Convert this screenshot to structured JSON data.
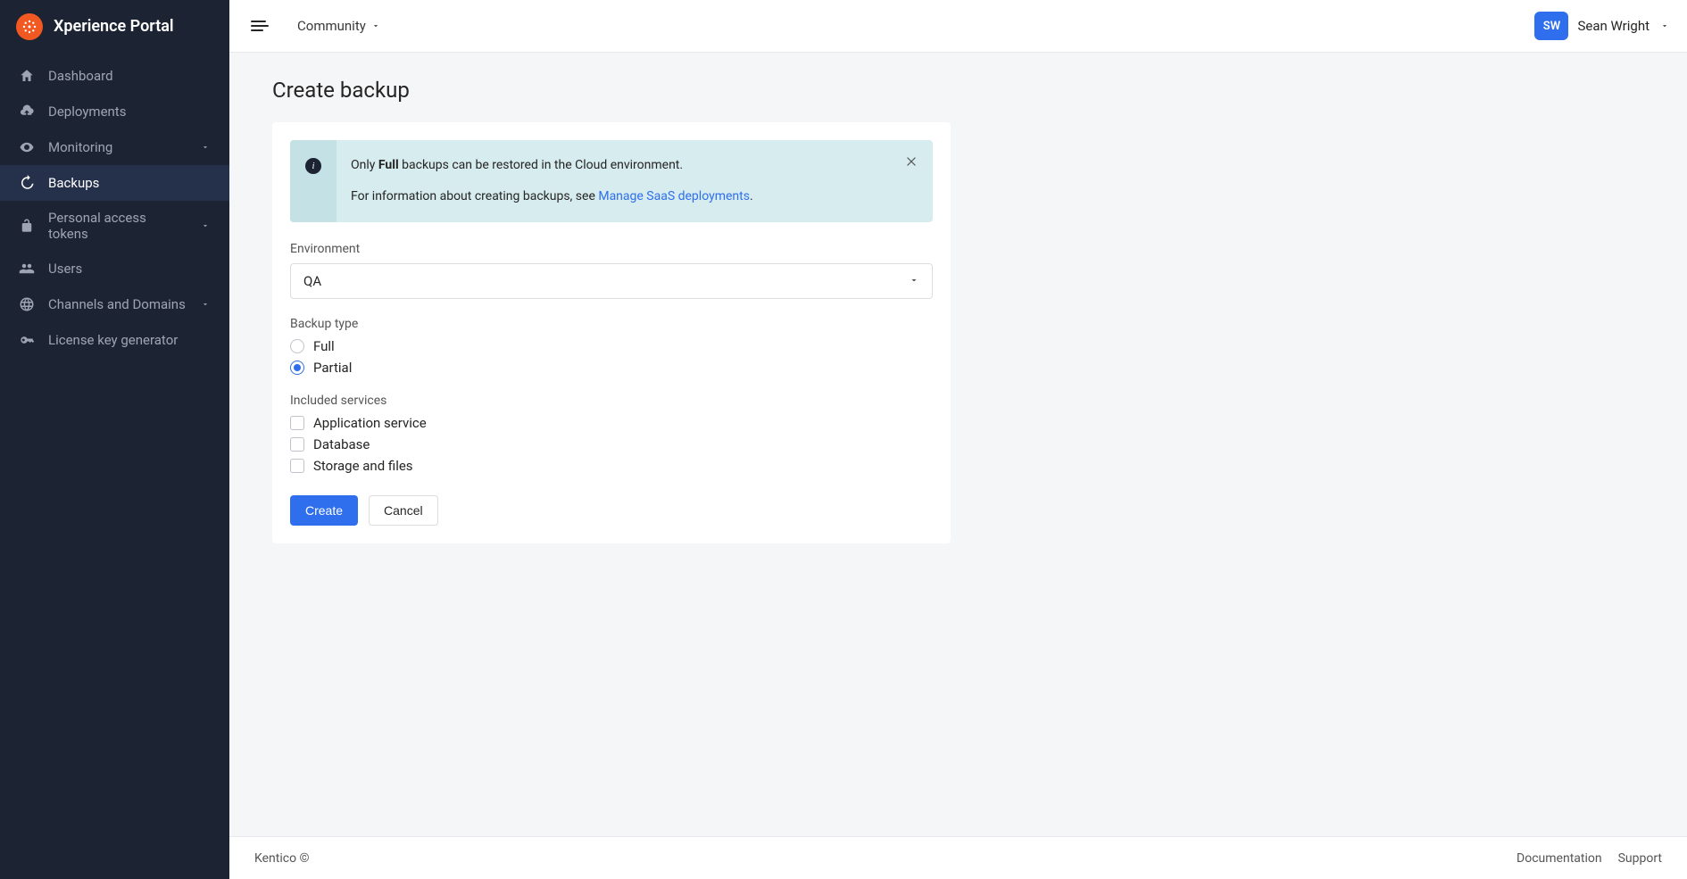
{
  "brand": {
    "title": "Xperience Portal"
  },
  "sidebar": {
    "items": [
      {
        "label": "Dashboard",
        "icon": "home-icon",
        "active": false,
        "expandable": false
      },
      {
        "label": "Deployments",
        "icon": "cloud-upload-icon",
        "active": false,
        "expandable": false
      },
      {
        "label": "Monitoring",
        "icon": "eye-icon",
        "active": false,
        "expandable": true
      },
      {
        "label": "Backups",
        "icon": "history-icon",
        "active": true,
        "expandable": false
      },
      {
        "label": "Personal access tokens",
        "icon": "lock-open-icon",
        "active": false,
        "expandable": true
      },
      {
        "label": "Users",
        "icon": "users-icon",
        "active": false,
        "expandable": false
      },
      {
        "label": "Channels and Domains",
        "icon": "globe-icon",
        "active": false,
        "expandable": true
      },
      {
        "label": "License key generator",
        "icon": "key-icon",
        "active": false,
        "expandable": false
      }
    ]
  },
  "topbar": {
    "project": "Community",
    "user": {
      "initials": "SW",
      "name": "Sean Wright"
    }
  },
  "page": {
    "title": "Create backup",
    "alert": {
      "line1_pre": "Only ",
      "line1_bold": "Full",
      "line1_post": " backups can be restored in the Cloud environment.",
      "line2_pre": "For information about creating backups, see ",
      "line2_link": "Manage SaaS deployments",
      "line2_post": "."
    },
    "environment": {
      "label": "Environment",
      "value": "QA"
    },
    "backup_type": {
      "label": "Backup type",
      "options": [
        {
          "label": "Full",
          "selected": false
        },
        {
          "label": "Partial",
          "selected": true
        }
      ]
    },
    "included_services": {
      "label": "Included services",
      "options": [
        {
          "label": "Application service",
          "checked": false
        },
        {
          "label": "Database",
          "checked": false
        },
        {
          "label": "Storage and files",
          "checked": false
        }
      ]
    },
    "buttons": {
      "create": "Create",
      "cancel": "Cancel"
    }
  },
  "footer": {
    "copyright": "Kentico ©",
    "links": [
      {
        "label": "Documentation"
      },
      {
        "label": "Support"
      }
    ]
  }
}
